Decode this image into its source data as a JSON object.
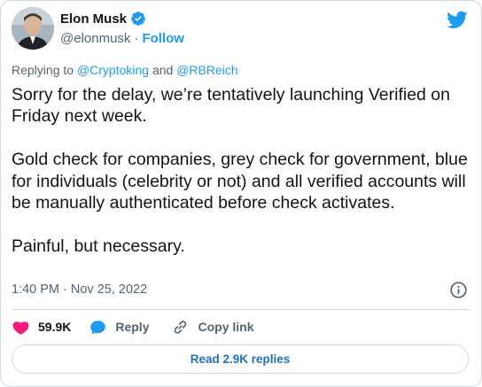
{
  "author": {
    "display_name": "Elon Musk",
    "handle": "@elonmusk",
    "separator": "·",
    "follow_label": "Follow",
    "verified_color": "#1d9bf0"
  },
  "reply_context": {
    "prefix": "Replying to ",
    "mention_1": "@Cryptoking",
    "joiner": " and ",
    "mention_2": "@RBReich"
  },
  "tweet": {
    "paragraphs": [
      "Sorry for the delay, we’re tentatively launching Verified on Friday next week.",
      "Gold check for companies, grey check for government, blue for individuals (celebrity or not) and all verified accounts will be manually authenticated before check activates.",
      "Painful, but necessary."
    ],
    "timestamp": "1:40 PM · Nov 25, 2022"
  },
  "actions": {
    "like_count": "59.9K",
    "reply_label": "Reply",
    "copy_link_label": "Copy link"
  },
  "read_replies_label": "Read 2.9K replies",
  "colors": {
    "accent": "#1d9bf0",
    "like": "#f91880",
    "muted": "#536471",
    "border": "#cfd9de"
  }
}
